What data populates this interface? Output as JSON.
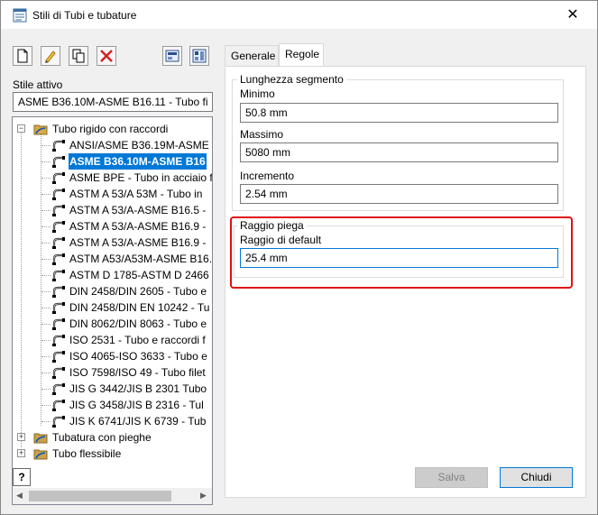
{
  "window": {
    "title": "Stili di Tubi e tubature",
    "close_glyph": "✕"
  },
  "toolbar": {
    "buttons": [
      {
        "name": "new-style-icon"
      },
      {
        "name": "edit-style-icon"
      },
      {
        "name": "copy-style-icon"
      },
      {
        "name": "delete-style-icon"
      },
      {
        "name": "import-style-icon"
      },
      {
        "name": "export-style-icon"
      }
    ]
  },
  "active_style": {
    "label": "Stile attivo",
    "value": "ASME B36.10M-ASME B16.11 - Tubo fi"
  },
  "tree": {
    "root1": "Tubo rigido con raccordi",
    "items": [
      "ANSI/ASME B36.19M-ASME B",
      "ASME B36.10M-ASME B16",
      "ASME BPE - Tubo in acciaio f",
      "ASTM A 53/A 53M - Tubo in",
      "ASTM A 53/A-ASME B16.5 -",
      "ASTM A 53/A-ASME B16.9 -",
      "ASTM A 53/A-ASME B16.9 -",
      "ASTM A53/A53M-ASME B16.",
      "ASTM D 1785-ASTM D 2466",
      "DIN 2458/DIN 2605 - Tubo e",
      "DIN 2458/DIN EN 10242 - Tu",
      "DIN 8062/DIN 8063 - Tubo e",
      "ISO 2531 - Tubo e raccordi f",
      "ISO 4065-ISO 3633 - Tubo e",
      "ISO 7598/ISO 49 - Tubo filet",
      "JIS G 3442/JIS B 2301 Tubo",
      "JIS G 3458/JIS B 2316 -   Tul",
      "JIS K 6741/JIS K 6739 - Tub"
    ],
    "selected_index": 1,
    "root2": "Tubatura con pieghe",
    "root3": "Tubo flessibile",
    "expand_minus": "−",
    "expand_plus": "+"
  },
  "help": {
    "label": "?"
  },
  "tabs": [
    {
      "label": "Generale",
      "active": false
    },
    {
      "label": "Regole",
      "active": true
    }
  ],
  "segment_length": {
    "title": "Lunghezza segmento",
    "min_label": "Minimo",
    "min_value": "50.8 mm",
    "max_label": "Massimo",
    "max_value": "5080 mm",
    "inc_label": "Incremento",
    "inc_value": "2.54 mm"
  },
  "bend_radius": {
    "title": "Raggio piega",
    "default_label": "Raggio di default",
    "default_value": "25.4 mm"
  },
  "buttons": {
    "save": "Salva",
    "close": "Chiudi"
  },
  "colors": {
    "selection": "#0078d7",
    "highlight_border": "#e01010",
    "focus_border": "#0078d7"
  }
}
